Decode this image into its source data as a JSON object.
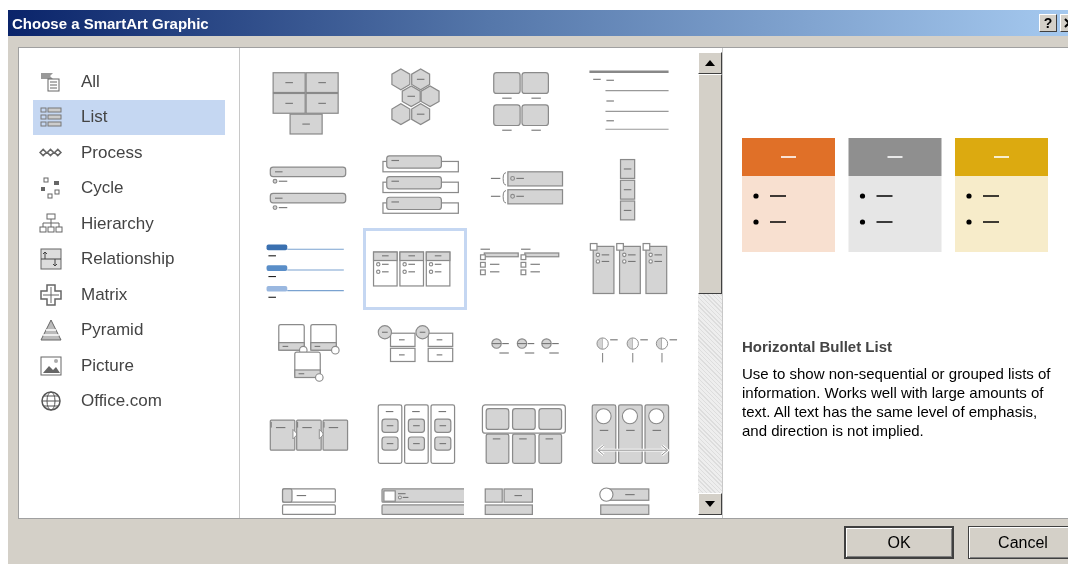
{
  "window": {
    "title": "Choose a SmartArt Graphic",
    "help_button": "?"
  },
  "categories": [
    {
      "label": "All",
      "selected": false
    },
    {
      "label": "List",
      "selected": true
    },
    {
      "label": "Process",
      "selected": false
    },
    {
      "label": "Cycle",
      "selected": false
    },
    {
      "label": "Hierarchy",
      "selected": false
    },
    {
      "label": "Relationship",
      "selected": false
    },
    {
      "label": "Matrix",
      "selected": false
    },
    {
      "label": "Pyramid",
      "selected": false
    },
    {
      "label": "Picture",
      "selected": false
    },
    {
      "label": "Office.com",
      "selected": false
    }
  ],
  "gallery": {
    "items": [
      {
        "selected": false
      },
      {
        "selected": false
      },
      {
        "selected": false
      },
      {
        "selected": false
      },
      {
        "selected": false
      },
      {
        "selected": false
      },
      {
        "selected": false
      },
      {
        "selected": false
      },
      {
        "selected": false
      },
      {
        "selected": true
      },
      {
        "selected": false
      },
      {
        "selected": false
      },
      {
        "selected": false
      },
      {
        "selected": false
      },
      {
        "selected": false
      },
      {
        "selected": false
      },
      {
        "selected": false
      },
      {
        "selected": false
      },
      {
        "selected": false
      },
      {
        "selected": false
      },
      {
        "selected": false
      },
      {
        "selected": false
      },
      {
        "selected": false
      },
      {
        "selected": false
      }
    ]
  },
  "preview": {
    "columns": [
      {
        "color": "#e07028"
      },
      {
        "color": "#8f8f8f"
      },
      {
        "color": "#dcaa10"
      }
    ],
    "title": "Horizontal Bullet List",
    "description": "Use to show non-sequential or grouped lists of information. Works well with large amounts of text. All text has the same level of emphasis, and direction is not implied."
  },
  "buttons": [
    {
      "label": "OK"
    },
    {
      "label": "Cancel"
    }
  ]
}
